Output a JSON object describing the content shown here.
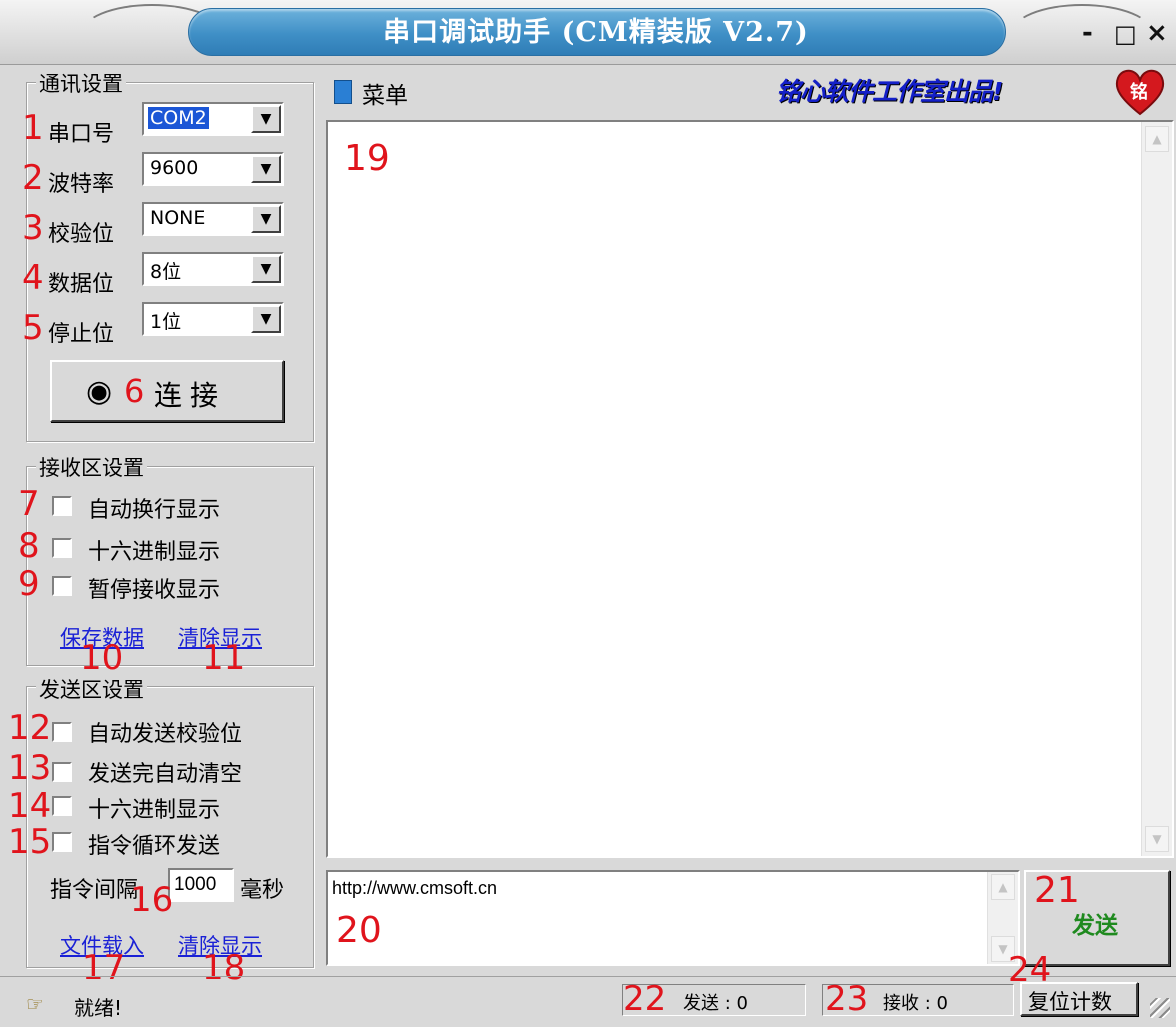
{
  "window": {
    "title": "串口调试助手 (CM精装版 V2.7)",
    "minimize": "-",
    "maximize": "□",
    "close": "×"
  },
  "comm": {
    "group_title": "通讯设置",
    "rows": [
      {
        "num": "1",
        "label": "串口号",
        "value": "COM2"
      },
      {
        "num": "2",
        "label": "波特率",
        "value": "9600"
      },
      {
        "num": "3",
        "label": "校验位",
        "value": "NONE"
      },
      {
        "num": "4",
        "label": "数据位",
        "value": "8位"
      },
      {
        "num": "5",
        "label": "停止位",
        "value": "1位"
      }
    ],
    "connect": {
      "num": "6",
      "label": "连接",
      "dot": "◉"
    }
  },
  "receive": {
    "group_title": "接收区设置",
    "options": [
      {
        "num": "7",
        "label": "自动换行显示"
      },
      {
        "num": "8",
        "label": "十六进制显示"
      },
      {
        "num": "9",
        "label": "暂停接收显示"
      }
    ],
    "save_link": "保存数据",
    "save_num": "10",
    "clear_link": "清除显示",
    "clear_num": "11"
  },
  "send": {
    "group_title": "发送区设置",
    "options": [
      {
        "num": "12",
        "label": "自动发送校验位"
      },
      {
        "num": "13",
        "label": "发送完自动清空"
      },
      {
        "num": "14",
        "label": "十六进制显示"
      },
      {
        "num": "15",
        "label": "指令循环发送"
      }
    ],
    "interval_label": "指令间隔",
    "interval_value": "1000",
    "interval_unit": "毫秒",
    "interval_num": "16",
    "load_link": "文件载入",
    "load_num": "17",
    "clear_link": "清除显示",
    "clear_num": "18"
  },
  "menu": {
    "label": "菜单",
    "banner": "铭心软件工作室出品!",
    "heart_text": "铭"
  },
  "receive_area": {
    "num": "19"
  },
  "send_area": {
    "text": "http://www.cmsoft.cn",
    "num": "20"
  },
  "send_button": {
    "label": "发送",
    "num": "21"
  },
  "status": {
    "ready": "就绪!",
    "sent_num": "22",
    "sent_label": "发送 : 0",
    "recv_num": "23",
    "recv_label": "接收 : 0",
    "reset_num": "24",
    "reset_label": "复位计数"
  }
}
